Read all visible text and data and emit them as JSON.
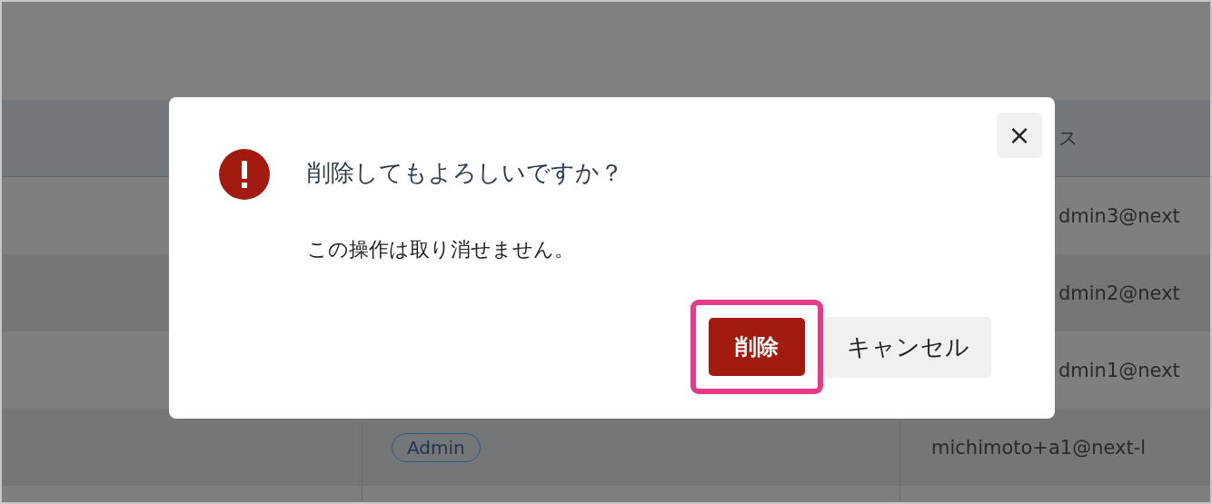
{
  "table": {
    "header": {
      "column_3": "ス",
      "partial": true
    },
    "rows": [
      {
        "email": "dmin3@next",
        "partial": true
      },
      {
        "email": "dmin2@next",
        "partial": true
      },
      {
        "email": "dmin1@next",
        "partial": true
      },
      {
        "role": "Admin",
        "email": "michimoto+a1@next-l",
        "partial": false
      }
    ]
  },
  "dialog": {
    "title": "削除してもよろしいですか？",
    "message": "この操作は取り消せません。",
    "close": "×",
    "buttons": [
      {
        "label": "削除",
        "kind": "danger",
        "highlighted": true
      },
      {
        "label": "キャンセル",
        "kind": "secondary",
        "highlighted": false
      }
    ]
  }
}
